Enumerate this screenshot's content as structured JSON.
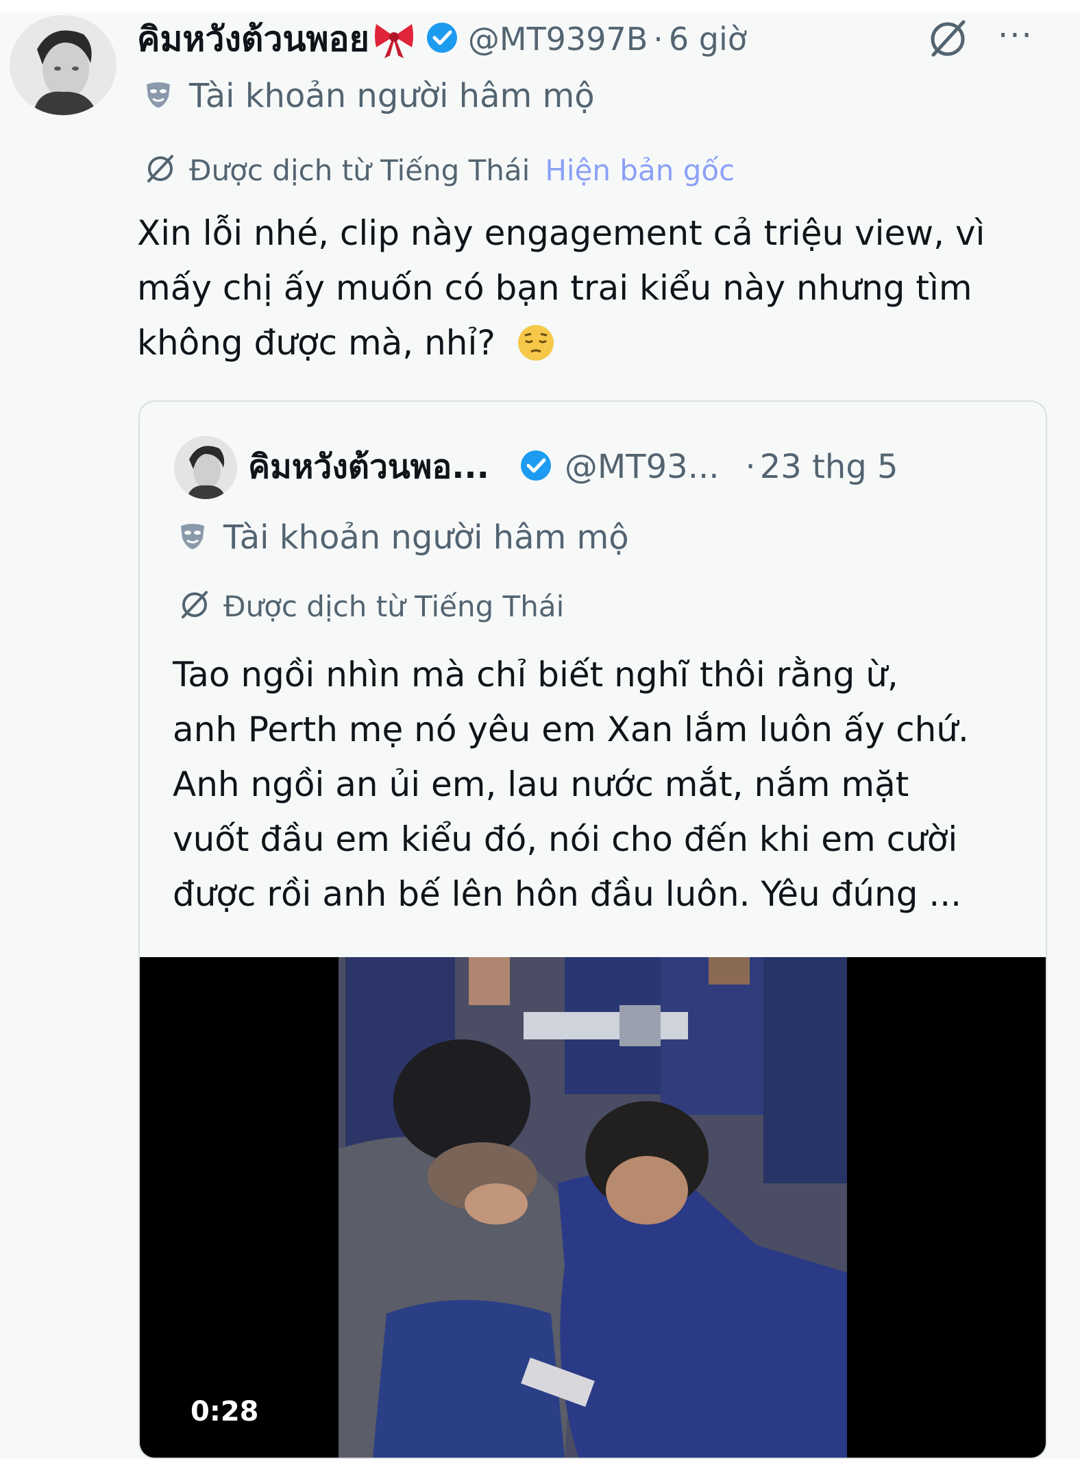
{
  "tweet": {
    "author": {
      "display_name": "คิมหวังต้วนพอย",
      "handle": "@MT9397B",
      "verified": true,
      "emoji": "ribbon-bow"
    },
    "separator": "·",
    "time": "6 giờ",
    "fan_account_label": "Tài khoản người hâm mộ",
    "translated_label": "Được dịch từ Tiếng Thái",
    "show_original_label": "Hiện bản gốc",
    "text_lines": [
      "Xin lỗi nhé, clip này engagement cả triệu view, vì",
      "mấy chị ấy muốn có bạn trai kiểu này nhưng tìm",
      "không được mà, nhỉ?"
    ],
    "text_emoji": "pensive-face",
    "more_label": "···"
  },
  "quoted_tweet": {
    "author": {
      "display_name": "คิมหวังต้วนพอ...",
      "handle": "@MT93...",
      "verified": true
    },
    "separator": "·",
    "time": "23 thg 5",
    "fan_account_label": "Tài khoản người hâm mộ",
    "translated_label": "Được dịch từ Tiếng Thái",
    "text_lines": [
      "Tao ngồi nhìn mà chỉ biết nghĩ thôi rằng ừ,",
      "anh Perth mẹ nó yêu em Xan lắm luôn ấy chứ.",
      "Anh ngồi an ủi em, lau nước mắt, nắm mặt",
      "vuốt đầu em kiểu đó, nói cho đến khi em cười",
      "được rồi anh bế lên hôn đầu luôn. Yêu đúng ..."
    ],
    "video": {
      "duration": "0:28"
    }
  },
  "colors": {
    "verified_blue": "#1d9bf0",
    "link_purple": "#8ba0f6",
    "secondary_text": "#536471",
    "uniform_blue": "#2b3a86"
  }
}
